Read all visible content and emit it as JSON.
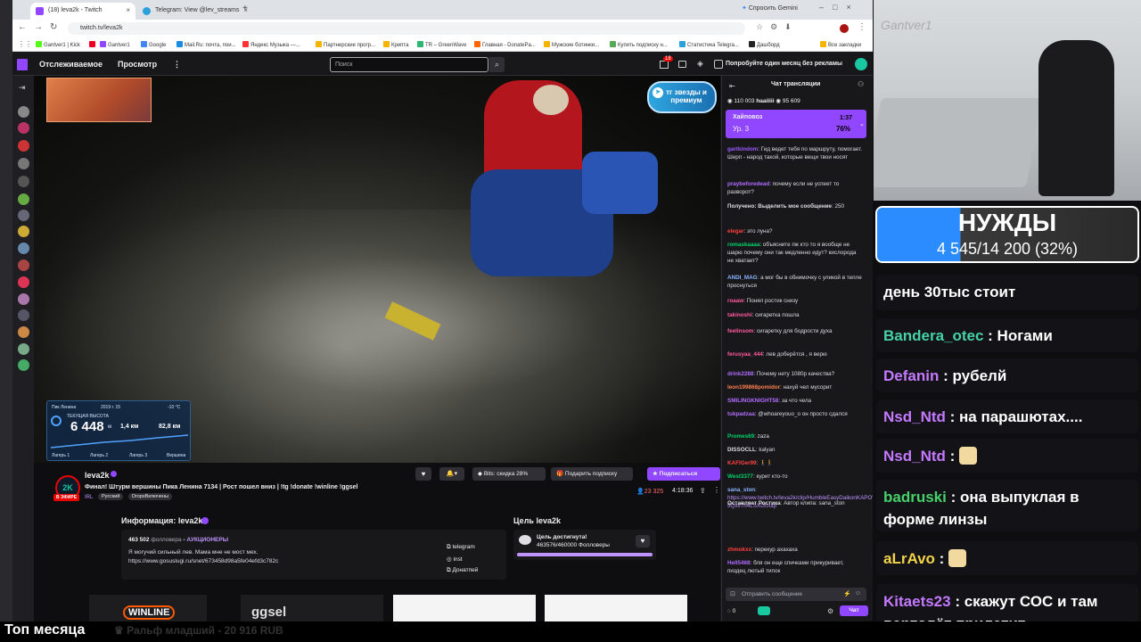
{
  "browser": {
    "tabs": [
      {
        "title": "(18) leva2k - Twitch",
        "active": true
      },
      {
        "title": "Telegram: View @lev_streams",
        "active": false
      }
    ],
    "new_tab": "+",
    "gemini": "Спросить Gemini",
    "url": "twitch.tv/leva2k",
    "bookmarks": [
      "Gantver1 | Kick",
      "Gantver1",
      "Google",
      "Mail.Ru: почта, пои...",
      "Яндекс Музыка —...",
      "Партнерские прогр...",
      "Крипта",
      "TR – GreenWave",
      "Главная - DonatePa...",
      "Мужские ботинки...",
      "Купить подписку н...",
      "Статистика Telegra...",
      "Дашборд"
    ],
    "all_bookmarks": "Все закладки"
  },
  "twitch_nav": {
    "following": "Отслеживаемое",
    "browse": "Просмотр",
    "more": "⋮",
    "search_placeholder": "Поиск",
    "notif_count": "18",
    "promo": "Попробуйте один месяц без рекламы"
  },
  "video": {
    "badge_top_right": "тг звезды и премиум",
    "hud_title": "Пик Ленина",
    "hud_date": "2019 г. 15",
    "hud_temp": "-10 °C",
    "hud_altitude_label": "ТЕКУЩАЯ ВЫСОТА",
    "hud_altitude": "6 448",
    "hud_altitude_unit": "м",
    "hud_speed": "1,4 км",
    "hud_distance": "82,8 км",
    "hud_labels": [
      "Лагерь 1",
      "Лагерь 2",
      "Лагерь 3",
      "Вершина"
    ]
  },
  "stream": {
    "channel": "leva2k",
    "title": "Финал! Штурм вершины Пика Ленина 7134 | Рост пошел вниз | !tg !donate !winline !ggsel",
    "live": "В ЭФИРЕ",
    "category": "IRL",
    "tags": [
      "Русский",
      "DropsВключены"
    ],
    "viewers": "23 325",
    "uptime": "4:18:36",
    "bits_btn": "Bits: скидка 28%",
    "gift_btn": "Подарить подписку",
    "subscribe_btn": "Подписаться"
  },
  "about": {
    "heading": "Информация: leva2k",
    "followers": "463 502",
    "followers_label": "фолловера",
    "group": "АУКЦИОНЕРЫ",
    "bio": "Я могучий сильный лев. Мама мне не мост мех.",
    "link": "https://www.gosuslugi.ru/snet/673458d98a5fe04efd3c782c",
    "links": [
      "telegram",
      "inst",
      "Донатпей"
    ]
  },
  "goal": {
    "heading": "Цель leva2k",
    "status": "Цель достигнута!",
    "progress_text": "463576/460000",
    "progress_label": "Фолловеры",
    "progress": 1.0
  },
  "panels": [
    "WINLINE",
    "ggsel"
  ],
  "chat": {
    "header": "Чат трансляции",
    "viewers": "110 003",
    "top_user": "haaiiiii",
    "top_user_count": "95 609",
    "hype_name": "Хайповоз",
    "hype_level": "Ур. 3",
    "hype_time": "1:37",
    "hype_percent": "76%",
    "messages": [
      {
        "user": "gartkindom",
        "color": "#9b59ff",
        "text": "Гид ведет тебя по маршруту, помогает. Шерп - народ такой, которые вещи твои носят"
      },
      {
        "user": "praybeforedead",
        "color": "#b06cff",
        "text": "почему если не успеет то разворот?"
      },
      {
        "user": "Получено: Выделить мое сообщение",
        "color": "#dedee3",
        "text": "250"
      },
      {
        "user": "elegar",
        "color": "#ff4040",
        "text": "это луна?"
      },
      {
        "user": "romaskaaaa",
        "color": "#00d26a",
        "text": "объясните пж кто то я вообще не шарю почему они так медленно идут? кислорода не хватает?"
      },
      {
        "user": "ANDI_MAG",
        "color": "#8ab4ff",
        "text": "а мог бы в обнимочку с уликой в тепле проснуться"
      },
      {
        "user": "roaaw",
        "color": "#ff5aa0",
        "text": "Понял ростик снизу"
      },
      {
        "user": "takinoshi",
        "color": "#ff5aa0",
        "text": "сигаретка пошла"
      },
      {
        "user": "feelinsom",
        "color": "#ff5aa0",
        "text": "сигаретку для бодрости духа"
      },
      {
        "user": "ferusyaa_444",
        "color": "#ff5aa0",
        "text": "лев доберётся , я верю"
      },
      {
        "user": "drink2288",
        "color": "#b06cff",
        "text": "Почему нету 1080p качества?"
      },
      {
        "user": "leon199868pomidor",
        "color": "#ff7f50",
        "text": "нахуй чел мусорит"
      },
      {
        "user": "SMILINGKNIGHT58",
        "color": "#b06cff",
        "text": "за что чела"
      },
      {
        "user": "tukpadzaa",
        "color": "#b06cff",
        "text": "@whoareyouo_o он просто сдался"
      },
      {
        "user": "Promes69",
        "color": "#00d26a",
        "text": "zaza"
      },
      {
        "user": "DISSOCLL",
        "color": "#dedee3",
        "text": "kalyan"
      },
      {
        "user": "KAFIGer99",
        "color": "#ff4040",
        "text": "🚶🚶"
      },
      {
        "user": "West3377",
        "color": "#00d26a",
        "text": "курит кто-то"
      },
      {
        "user": "sana_ston",
        "color": "#8ab4ff",
        "text": "https://www.twitch.tv/leva2k/clip/HumbleEasyDaikonKAPOW-5Qxif7n4LSXGUuqr"
      },
      {
        "user": "Оставляет Ростика",
        "color": "#dedee3",
        "text": "Автор клипа: sana_ston"
      },
      {
        "user": "zhmokxx",
        "color": "#ff4040",
        "text": "перекур ахахаха"
      },
      {
        "user": "Hell5468",
        "color": "#b06cff",
        "text": "бля он еще спичками прикуривает, пиздец лютый типок"
      }
    ],
    "input_placeholder": "Отправить сообщение",
    "points": "0",
    "send_btn": "Чат"
  },
  "overlay": {
    "cam_watermark": "Gantver1",
    "goal_title": "НУЖДЫ",
    "goal_progress": "4 545/14 200 (32%)",
    "goal_fraction": 0.32,
    "chat": [
      {
        "user": "",
        "color": "#fff",
        "text": "день 30тыс стоит"
      },
      {
        "user": "Bandera_otec",
        "color": "#46d1a6",
        "text": "Ногами"
      },
      {
        "user": "Defanin",
        "color": "#c479ff",
        "text": "рубелй"
      },
      {
        "user": "Nsd_Ntd",
        "color": "#c479ff",
        "text": "на парашютах...."
      },
      {
        "user": "Nsd_Ntd",
        "color": "#c479ff",
        "text": ""
      },
      {
        "user": "badruski",
        "color": "#46d16a",
        "text": "она выпуклая в форме линзы"
      },
      {
        "user": "aLrAvo",
        "color": "#f2d44a",
        "text": ""
      },
      {
        "user": "Kitaets23",
        "color": "#c479ff",
        "text": "скажут СОС и там вертолёт прилетит"
      }
    ],
    "bottom_left": "Топ месяца",
    "bottom_ticker": "Ральф младший - 20 916 RUB"
  }
}
